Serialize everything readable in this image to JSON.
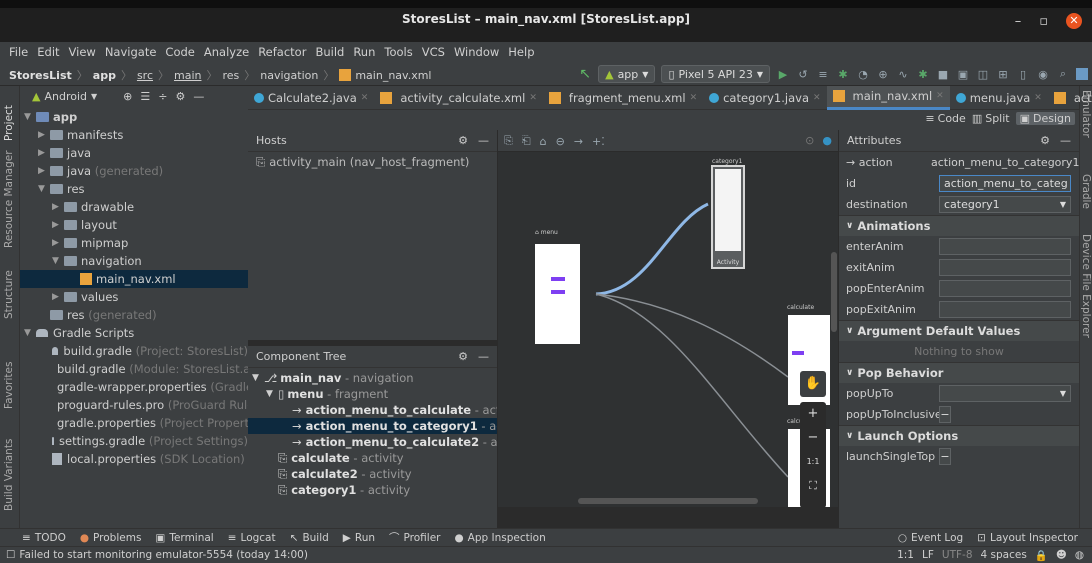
{
  "window": {
    "title": "StoresList – main_nav.xml [StoresList.app]"
  },
  "menu": [
    "File",
    "Edit",
    "View",
    "Navigate",
    "Code",
    "Analyze",
    "Refactor",
    "Build",
    "Run",
    "Tools",
    "VCS",
    "Window",
    "Help"
  ],
  "breadcrumb": {
    "project": "StoresList",
    "module": "app",
    "src": "src",
    "main": "main",
    "res": "res",
    "navigation": "navigation",
    "file": "main_nav.xml"
  },
  "toolbar": {
    "run_config": "app",
    "device": "Pixel 5 API 23"
  },
  "left_tools": [
    "Project",
    "Resource Manager",
    "Structure",
    "Favorites",
    "Build Variants"
  ],
  "right_tools": [
    "Emulator",
    "Gradle",
    "Device File Explorer"
  ],
  "project_panel": {
    "view": "Android",
    "tree": [
      {
        "label": "app",
        "extra": ""
      },
      {
        "label": "manifests",
        "extra": ""
      },
      {
        "label": "java",
        "extra": ""
      },
      {
        "label": "java",
        "extra": "(generated)"
      },
      {
        "label": "res",
        "extra": ""
      },
      {
        "label": "drawable",
        "extra": ""
      },
      {
        "label": "layout",
        "extra": ""
      },
      {
        "label": "mipmap",
        "extra": ""
      },
      {
        "label": "navigation",
        "extra": ""
      },
      {
        "label": "main_nav.xml",
        "extra": ""
      },
      {
        "label": "values",
        "extra": ""
      },
      {
        "label": "res",
        "extra": "(generated)"
      },
      {
        "label": "Gradle Scripts",
        "extra": ""
      },
      {
        "label": "build.gradle",
        "extra": "(Project: StoresList)"
      },
      {
        "label": "build.gradle",
        "extra": "(Module: StoresList.app)"
      },
      {
        "label": "gradle-wrapper.properties",
        "extra": "(Gradle Version)"
      },
      {
        "label": "proguard-rules.pro",
        "extra": "(ProGuard Rules for StoresList.app)"
      },
      {
        "label": "gradle.properties",
        "extra": "(Project Properties)"
      },
      {
        "label": "settings.gradle",
        "extra": "(Project Settings)"
      },
      {
        "label": "local.properties",
        "extra": "(SDK Location)"
      }
    ]
  },
  "editor_tabs": [
    "Calculate2.java",
    "activity_calculate.xml",
    "fragment_menu.xml",
    "category1.java",
    "main_nav.xml",
    "menu.java",
    "activ"
  ],
  "view_modes": {
    "code": "Code",
    "split": "Split",
    "design": "Design"
  },
  "hosts": {
    "title": "Hosts",
    "item": "activity_main (nav_host_fragment)"
  },
  "component_tree": {
    "title": "Component Tree",
    "nodes": [
      {
        "name": "main_nav",
        "type": "- navigation"
      },
      {
        "name": "menu",
        "type": "- fragment"
      },
      {
        "name": "action_menu_to_calculate",
        "type": "- action"
      },
      {
        "name": "action_menu_to_category1",
        "type": "- action"
      },
      {
        "name": "action_menu_to_calculate2",
        "type": "- action"
      },
      {
        "name": "calculate",
        "type": "- activity"
      },
      {
        "name": "calculate2",
        "type": "- activity"
      },
      {
        "name": "category1",
        "type": "- activity"
      }
    ]
  },
  "canvas": {
    "menu_label": "menu",
    "category_label": "category1",
    "activity_label": "Activity",
    "calculate_label": "calculate",
    "calcul_label": "calcul",
    "zoom_label": "1:1"
  },
  "attributes": {
    "title": "Attributes",
    "action_label": "action",
    "action_value": "action_menu_to_category1",
    "id_label": "id",
    "id_value": "action_menu_to_categ",
    "destination_label": "destination",
    "destination_value": "category1",
    "animations": "Animations",
    "enter_anim": "enterAnim",
    "exit_anim": "exitAnim",
    "pop_enter_anim": "popEnterAnim",
    "pop_exit_anim": "popExitAnim",
    "arg_defaults": "Argument Default Values",
    "nothing_to_show": "Nothing to show",
    "pop_behavior": "Pop Behavior",
    "pop_up_to": "popUpTo",
    "pop_up_to_inclusive": "popUpToInclusive",
    "launch_options": "Launch Options",
    "launch_single_top": "launchSingleTop"
  },
  "bottom_tools": [
    "TODO",
    "Problems",
    "Terminal",
    "Logcat",
    "Build",
    "Run",
    "Profiler",
    "App Inspection"
  ],
  "bottom_right_tools": [
    "Event Log",
    "Layout Inspector"
  ],
  "status": {
    "message": "Failed to start monitoring emulator-5554 (today 14:00)",
    "position": "1:1",
    "line_sep": "LF",
    "encoding": "UTF-8",
    "indent": "4 spaces"
  },
  "colors": {
    "accent": "#4a88c7",
    "selection": "#0d293e",
    "close": "#e95420",
    "nav_arrow": "#8fb8e6",
    "fragment_btn": "#7e3ff2"
  }
}
